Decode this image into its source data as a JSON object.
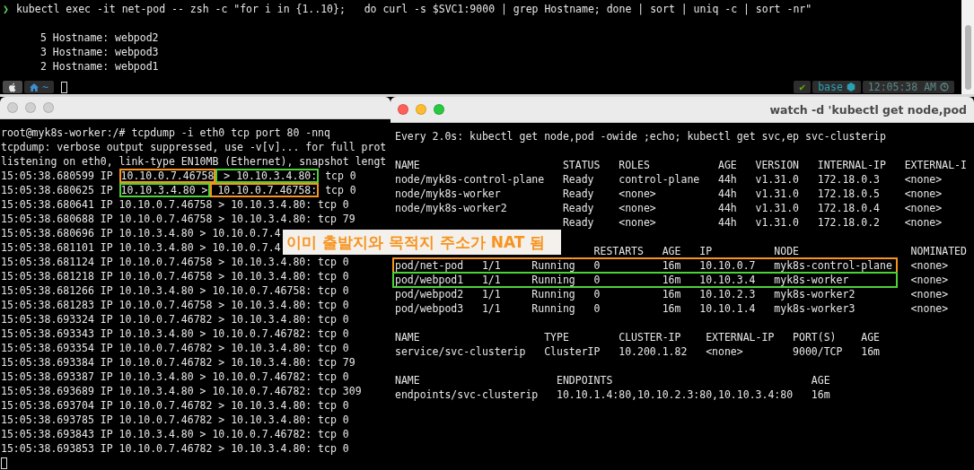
{
  "top_terminal": {
    "prompt": {
      "symbol": "❯",
      "command": "kubectl exec -it net-pod -- zsh -c \"for i in {1..10};   do curl -s $SVC1:9000 | grep Hostname; done | sort | uniq -c | sort -nr\""
    },
    "output": [
      "5 Hostname: webpod2",
      "3 Hostname: webpod3",
      "2 Hostname: webpod1"
    ],
    "status_bar": {
      "directory": "~",
      "status": "✔",
      "environment": "base",
      "time": "12:05:38 AM"
    }
  },
  "left_window": {
    "focused": false,
    "lines": [
      [
        {
          "text": "root@myk8s-worker:/# tcpdump -i eth0 tcp port 80 -nnq"
        }
      ],
      [
        {
          "text": "tcpdump: verbose output suppressed, use -v[v]... for full prot"
        }
      ],
      [
        {
          "text": "listening on eth0, link-type EN10MB (Ethernet), snapshot lengt"
        }
      ],
      [
        {
          "text": "15:05:38.680599 IP "
        },
        {
          "text": "10.10.0.7.46758",
          "color": "#f7931e"
        },
        {
          "text": " > 10.10.3.4.80:",
          "color": "#4cd137"
        },
        {
          "text": " tcp 0"
        }
      ],
      [
        {
          "text": "15:05:38.680625 IP "
        },
        {
          "text": "10.10.3.4.80 >",
          "color": "#4cd137"
        },
        {
          "text": " 10.10.0.7.46758:",
          "color": "#f7931e"
        },
        {
          "text": " tcp 0"
        }
      ],
      [
        {
          "text": "15:05:38.680641 IP 10.10.0.7.46758 > 10.10.3.4.80: tcp 0"
        }
      ],
      [
        {
          "text": "15:05:38.680688 IP 10.10.0.7.46758 > 10.10.3.4.80: tcp 79"
        }
      ],
      [
        {
          "text": "15:05:38.680696 IP 10.10.3.4.80 > 10.10.0.7.4"
        }
      ],
      [
        {
          "text": "15:05:38.681101 IP 10.10.3.4.80 > 10.10.0.7.4"
        }
      ],
      [
        {
          "text": "15:05:38.681124 IP 10.10.0.7.46758 > 10.10.3.4.80: tcp 0"
        }
      ],
      [
        {
          "text": "15:05:38.681218 IP 10.10.0.7.46758 > 10.10.3.4.80: tcp 0"
        }
      ],
      [
        {
          "text": "15:05:38.681266 IP 10.10.3.4.80 > 10.10.0.7.46758: tcp 0"
        }
      ],
      [
        {
          "text": "15:05:38.681283 IP 10.10.0.7.46758 > 10.10.3.4.80: tcp 0"
        }
      ],
      [
        {
          "text": "15:05:38.693324 IP 10.10.0.7.46782 > 10.10.3.4.80: tcp 0"
        }
      ],
      [
        {
          "text": "15:05:38.693343 IP 10.10.3.4.80 > 10.10.0.7.46782: tcp 0"
        }
      ],
      [
        {
          "text": "15:05:38.693354 IP 10.10.0.7.46782 > 10.10.3.4.80: tcp 0"
        }
      ],
      [
        {
          "text": "15:05:38.693384 IP 10.10.0.7.46782 > 10.10.3.4.80: tcp 79"
        }
      ],
      [
        {
          "text": "15:05:38.693387 IP 10.10.3.4.80 > 10.10.0.7.46782: tcp 0"
        }
      ],
      [
        {
          "text": "15:05:38.693689 IP 10.10.3.4.80 > 10.10.0.7.46782: tcp 309"
        }
      ],
      [
        {
          "text": "15:05:38.693704 IP 10.10.0.7.46782 > 10.10.3.4.80: tcp 0"
        }
      ],
      [
        {
          "text": "15:05:38.693785 IP 10.10.0.7.46782 > 10.10.3.4.80: tcp 0"
        }
      ],
      [
        {
          "text": "15:05:38.693843 IP 10.10.3.4.80 > 10.10.0.7.46782: tcp 0"
        }
      ],
      [
        {
          "text": "15:05:38.693853 IP 10.10.0.7.46782 > 10.10.3.4.80: tcp 0"
        }
      ]
    ]
  },
  "right_window": {
    "focused": true,
    "title": "watch -d 'kubectl get node,pod",
    "header": "Every 2.0s: kubectl get node,pod -owide ;echo; kubectl get svc,ep svc-clusterip",
    "tables": [
      {
        "kind": "nodes",
        "columns": [
          "NAME",
          "STATUS",
          "ROLES",
          "AGE",
          "VERSION",
          "INTERNAL-IP",
          "EXTERNAL-I"
        ],
        "rows": [
          {
            "cells": [
              "node/myk8s-control-plane",
              "Ready",
              "control-plane",
              "44h",
              "v1.31.0",
              "172.18.0.3",
              "<none>"
            ]
          },
          {
            "cells": [
              "node/myk8s-worker",
              "Ready",
              "<none>",
              "44h",
              "v1.31.0",
              "172.18.0.5",
              "<none>"
            ]
          },
          {
            "cells": [
              "node/myk8s-worker2",
              "Ready",
              "<none>",
              "44h",
              "v1.31.0",
              "172.18.0.4",
              "<none>"
            ]
          },
          {
            "cells": [
              null,
              "Ready",
              "<none>",
              "44h",
              "v1.31.0",
              "172.18.0.2",
              "<none>"
            ]
          }
        ]
      },
      {
        "kind": "pods",
        "columns": [
          null,
          null,
          null,
          "RESTARTS",
          "AGE",
          "IP",
          "NODE",
          "NOMINATED"
        ],
        "rows": [
          {
            "cells": [
              "pod/net-pod",
              "1/1",
              "Running",
              "0",
              "16m",
              "10.10.0.7",
              "myk8s-control-plane",
              "<none>"
            ],
            "color": "#f7931e"
          },
          {
            "cells": [
              "pod/webpod1",
              "1/1",
              "Running",
              "0",
              "16m",
              "10.10.3.4",
              "myk8s-worker",
              "<none>"
            ],
            "color": "#4cd137"
          },
          {
            "cells": [
              "pod/webpod2",
              "1/1",
              "Running",
              "0",
              "16m",
              "10.10.2.3",
              "myk8s-worker2",
              "<none>"
            ]
          },
          {
            "cells": [
              "pod/webpod3",
              "1/1",
              "Running",
              "0",
              "16m",
              "10.10.1.4",
              "myk8s-worker3",
              "<none>"
            ]
          }
        ]
      },
      {
        "kind": "services",
        "columns": [
          "NAME",
          "TYPE",
          "CLUSTER-IP",
          "EXTERNAL-IP",
          "PORT(S)",
          "AGE"
        ],
        "rows": [
          {
            "cells": [
              "service/svc-clusterip",
              "ClusterIP",
              "10.200.1.82",
              "<none>",
              "9000/TCP",
              "16m"
            ]
          }
        ]
      },
      {
        "kind": "endpoints",
        "columns": [
          "NAME",
          "ENDPOINTS",
          "AGE"
        ],
        "rows": [
          {
            "cells": [
              "endpoints/svc-clusterip",
              "10.10.1.4:80,10.10.2.3:80,10.10.3.4:80",
              "16m"
            ]
          }
        ]
      }
    ]
  },
  "annotation": {
    "text": "이미 출발지와 목적지 주소가 NAT 됨"
  }
}
